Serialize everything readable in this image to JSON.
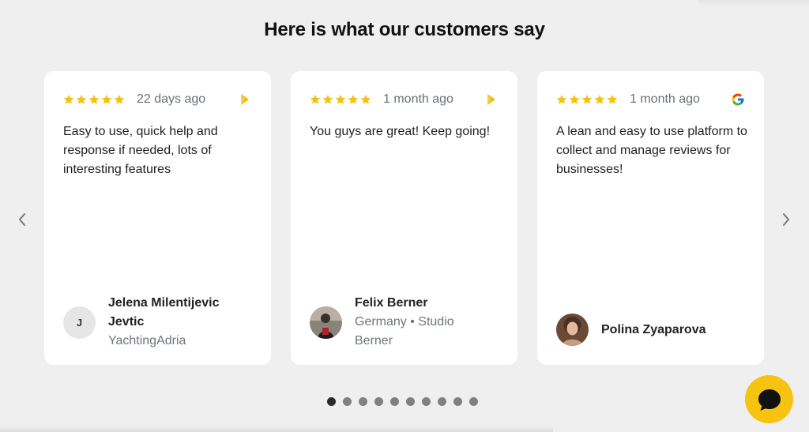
{
  "section": {
    "title": "Here is what our customers say"
  },
  "colors": {
    "star": "#F5C30F",
    "chat_button": "#F5C310",
    "active_dot": "#2B2B2B",
    "inactive_dot": "#808080"
  },
  "reviews": [
    {
      "rating": 5,
      "date": "22 days ago",
      "source_icon": "chevron-source-icon",
      "text": "Easy to use, quick help and response if needed, lots of interesting features",
      "author_initial": "J",
      "author_name": "Jelena Milentijevic Jevtic",
      "author_subtitle": "YachtingAdria"
    },
    {
      "rating": 5,
      "date": "1 month ago",
      "source_icon": "chevron-source-icon",
      "text": "You guys are great! Keep going!",
      "author_name": "Felix Berner",
      "author_subtitle": "Germany • Studio Berner"
    },
    {
      "rating": 5,
      "date": "1 month ago",
      "source_icon": "google-icon",
      "text": "A lean and easy to use platform to collect and manage reviews for businesses!",
      "author_name": "Polina Zyaparova"
    }
  ],
  "pagination": {
    "total": 10,
    "active": 1
  },
  "icons": {
    "prev": "chevron-left-icon",
    "next": "chevron-right-icon",
    "chat": "chat-bubble-icon"
  }
}
